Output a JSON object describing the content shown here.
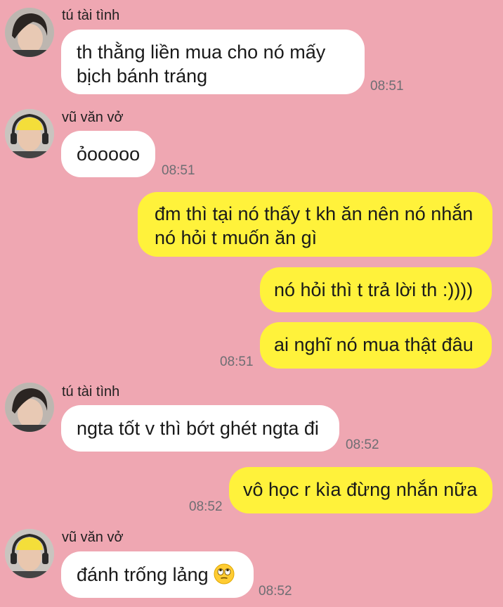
{
  "messages": [
    {
      "sender": "tú tài tình",
      "text": "th thằng liền mua cho nó mấy bịch bánh tráng",
      "time": "08:51"
    },
    {
      "sender": "vũ văn vở",
      "text": "ỏooooo",
      "time": "08:51"
    },
    {
      "sender": "me",
      "text": "đm thì tại nó thấy t kh ăn nên nó nhắn nó hỏi t muốn ăn gì"
    },
    {
      "sender": "me",
      "text": "nó hỏi thì t trả lời th :))))"
    },
    {
      "sender": "me",
      "text": "ai nghĩ nó mua thật đâu",
      "time": "08:51"
    },
    {
      "sender": "tú tài tình",
      "text": "ngta tốt v thì bớt ghét ngta đi",
      "time": "08:52"
    },
    {
      "sender": "me",
      "text": "vô học r kìa đừng nhắn nữa",
      "time": "08:52"
    },
    {
      "sender": "vũ văn vở",
      "text": "đánh trống lảng",
      "emoji": "eye-roll-face",
      "time": "08:52"
    }
  ],
  "colors": {
    "background": "#EFA7B2",
    "incoming_bubble": "#FFFFFF",
    "outgoing_bubble": "#FFF23B",
    "timestamp": "#6e6e73"
  }
}
